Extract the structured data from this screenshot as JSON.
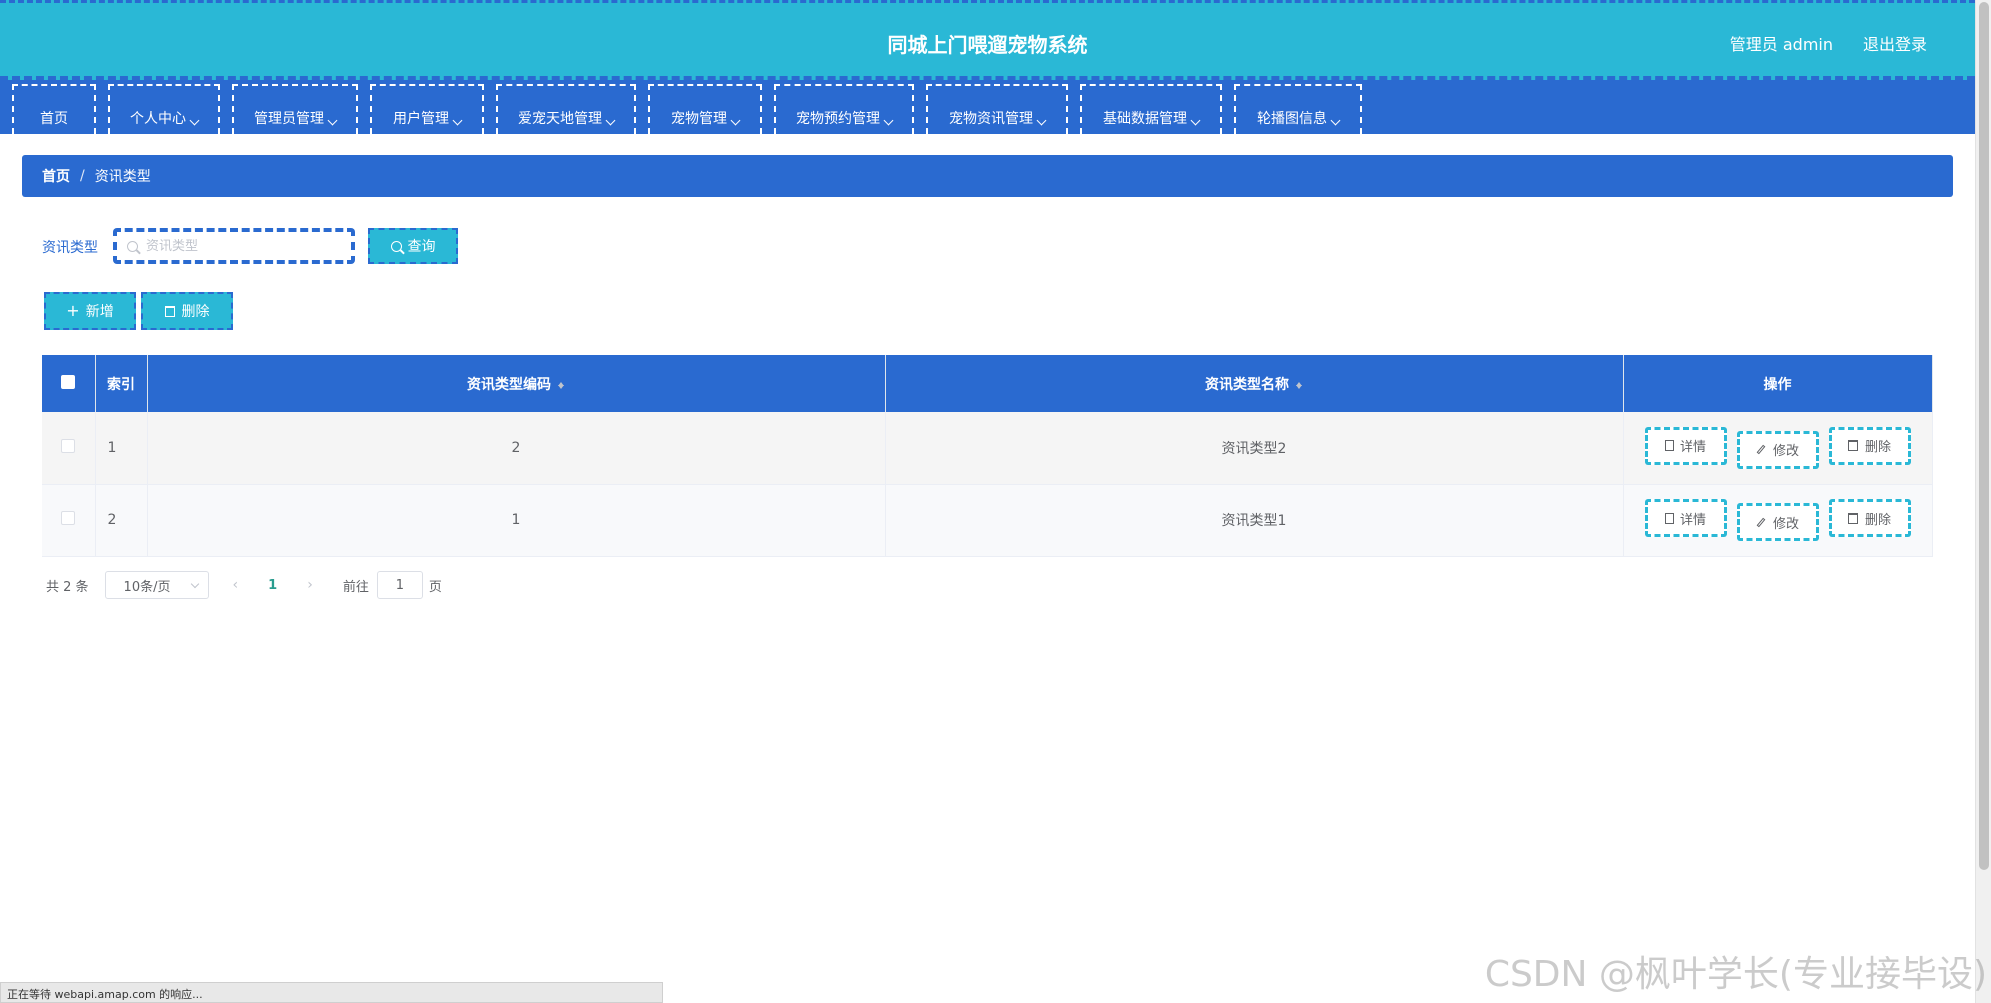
{
  "header": {
    "title": "同城上门喂遛宠物系统",
    "user_label": "管理员 admin",
    "logout_label": "退出登录"
  },
  "nav": {
    "items": [
      {
        "label": "首页",
        "has_dropdown": false
      },
      {
        "label": "个人中心",
        "has_dropdown": true
      },
      {
        "label": "管理员管理",
        "has_dropdown": true
      },
      {
        "label": "用户管理",
        "has_dropdown": true
      },
      {
        "label": "爱宠天地管理",
        "has_dropdown": true
      },
      {
        "label": "宠物管理",
        "has_dropdown": true
      },
      {
        "label": "宠物预约管理",
        "has_dropdown": true
      },
      {
        "label": "宠物资讯管理",
        "has_dropdown": true
      },
      {
        "label": "基础数据管理",
        "has_dropdown": true
      },
      {
        "label": "轮播图信息",
        "has_dropdown": true
      }
    ]
  },
  "breadcrumb": {
    "home": "首页",
    "separator": "/",
    "current": "资讯类型"
  },
  "search": {
    "label": "资讯类型",
    "placeholder": "资讯类型",
    "value": "",
    "query_button": "查询"
  },
  "actions": {
    "add_button": "新增",
    "delete_button": "删除"
  },
  "table": {
    "columns": [
      "索引",
      "资讯类型编码",
      "资讯类型名称",
      "操作"
    ],
    "rows": [
      {
        "index": "1",
        "code": "2",
        "name": "资讯类型2"
      },
      {
        "index": "2",
        "code": "1",
        "name": "资讯类型1"
      }
    ],
    "row_actions": {
      "detail": "详情",
      "edit": "修改",
      "delete": "删除"
    }
  },
  "pagination": {
    "total_text": "共 2 条",
    "page_size": "10条/页",
    "current_page": "1",
    "goto_label": "前往",
    "goto_value": "1",
    "goto_suffix": "页"
  },
  "status_bar": {
    "text": "正在等待 webapi.amap.com 的响应..."
  },
  "watermark": "CSDN @枫叶学长(专业接毕设)",
  "colors": {
    "header_bg": "#2ab8d6",
    "nav_bg": "#2a6ad0",
    "accent": "#2ab8d6",
    "page_active": "#2a9d8f"
  }
}
